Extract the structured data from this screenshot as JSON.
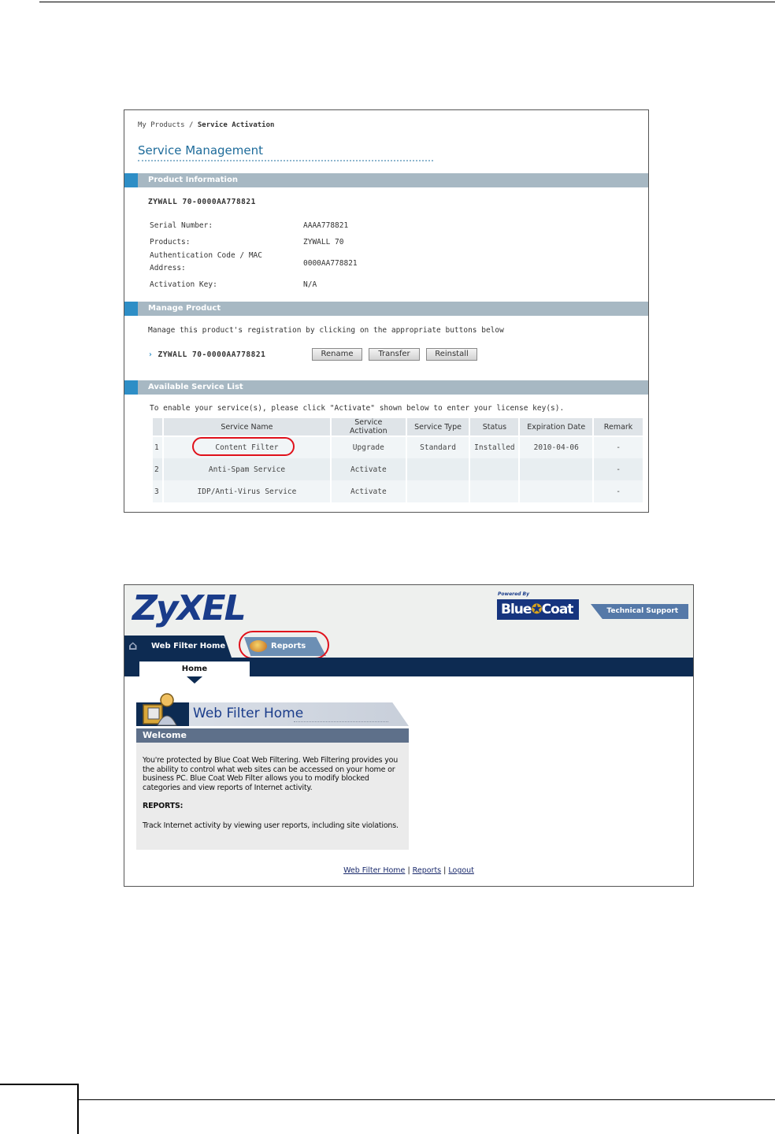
{
  "service_activation": {
    "breadcrumb": {
      "parent": "My Products",
      "separator": "/",
      "current": "Service Activation"
    },
    "title": "Service Management",
    "product_info": {
      "header": "Product Information",
      "product_id": "ZYWALL 70-0000AA778821",
      "fields": [
        {
          "label": "Serial Number:",
          "value": "AAAA778821"
        },
        {
          "label": "Products:",
          "value": "ZYWALL 70"
        },
        {
          "label_line1": "Authentication Code / MAC",
          "label_line2": "Address:",
          "value": "0000AA778821"
        },
        {
          "label": "Activation Key:",
          "value": "N/A"
        }
      ]
    },
    "manage_product": {
      "header": "Manage Product",
      "description": "Manage this product's registration by clicking on the appropriate buttons below",
      "product_link": "ZYWALL 70-0000AA778821",
      "buttons": {
        "rename": "Rename",
        "transfer": "Transfer",
        "reinstall": "Reinstall"
      }
    },
    "service_list": {
      "header": "Available Service List",
      "instructions": "To enable your service(s), please click \"Activate\" shown below to enter your license key(s).",
      "columns": [
        "Service Name",
        "Service Activation",
        "Service Type",
        "Status",
        "Expiration Date",
        "Remark"
      ],
      "rows": [
        {
          "index": "1",
          "name": "Content Filter",
          "activation": "Upgrade",
          "type": "Standard",
          "status": "Installed",
          "expiration": "2010-04-06",
          "remark": "-"
        },
        {
          "index": "2",
          "name": "Anti-Spam Service",
          "activation": "Activate",
          "type": "",
          "status": "",
          "expiration": "",
          "remark": "-"
        },
        {
          "index": "3",
          "name": "IDP/Anti-Virus Service",
          "activation": "Activate",
          "type": "",
          "status": "",
          "expiration": "",
          "remark": "-"
        }
      ]
    }
  },
  "web_filter": {
    "logo": "ZyXEL",
    "powered_by": "Powered By",
    "partner_logo": {
      "left": "Blue",
      "right": "Coat"
    },
    "support_button": "Technical Support",
    "tabs": {
      "home": "Web Filter Home",
      "reports": "Reports"
    },
    "subtab": "Home",
    "panel_title": "Web Filter Home",
    "welcome_header": "Welcome",
    "welcome_text": "You're protected by Blue Coat Web Filtering. Web Filtering provides you the ability to control what web sites can be accessed on your home or business PC. Blue Coat Web Filter allows you to modify blocked categories and view reports of Internet activity.",
    "reports_heading": "REPORTS:",
    "reports_text": "Track Internet activity by viewing user reports, including site violations.",
    "footer_links": {
      "home": "Web Filter Home",
      "sep": "|",
      "reports": "Reports",
      "logout": "Logout"
    }
  },
  "colors": {
    "highlight": "#e0111b",
    "navy": "#0d2b52",
    "section_bar": "#a7b8c3"
  },
  "icons": [
    "house-icon",
    "reports-icon",
    "web-filter-user-icon",
    "chevron-right-icon"
  ]
}
